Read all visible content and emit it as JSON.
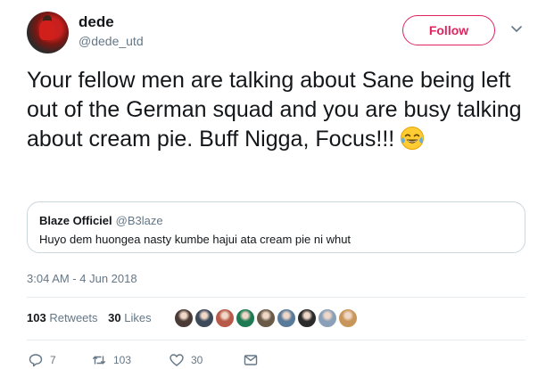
{
  "author": {
    "display_name": "dede",
    "handle": "@dede_utd"
  },
  "header": {
    "follow_label": "Follow",
    "accent_color": "#e0245e"
  },
  "tweet": {
    "text": "Your fellow men are talking about Sane being left out of the German squad and you are busy talking about cream pie. Buff Nigga, Focus!!!",
    "emoji": "face-with-tears-of-joy",
    "timestamp": "3:04 AM - 4 Jun 2018"
  },
  "quoted_tweet": {
    "author_name": "Blaze Officiel",
    "author_handle": "@B3laze",
    "text": "Huyo dem huongea nasty kumbe hajui ata cream pie ni whut"
  },
  "stats": {
    "retweets_count": "103",
    "retweets_label": "Retweets",
    "likes_count": "30",
    "likes_label": "Likes"
  },
  "likers": [
    {
      "icon": "liker-avatar-1",
      "color": "#4a3b36"
    },
    {
      "icon": "liker-avatar-2",
      "color": "#3d4a5a"
    },
    {
      "icon": "liker-avatar-3",
      "color": "#b85a4a"
    },
    {
      "icon": "liker-avatar-4",
      "color": "#1e7a52"
    },
    {
      "icon": "liker-avatar-5",
      "color": "#6a5a48"
    },
    {
      "icon": "liker-avatar-6",
      "color": "#5a7a9a"
    },
    {
      "icon": "liker-avatar-7",
      "color": "#2b2b2b"
    },
    {
      "icon": "liker-avatar-8",
      "color": "#8aa0b8"
    },
    {
      "icon": "liker-avatar-9",
      "color": "#c8965a"
    }
  ],
  "actions": {
    "reply_count": "7",
    "retweet_count": "103",
    "like_count": "30"
  }
}
